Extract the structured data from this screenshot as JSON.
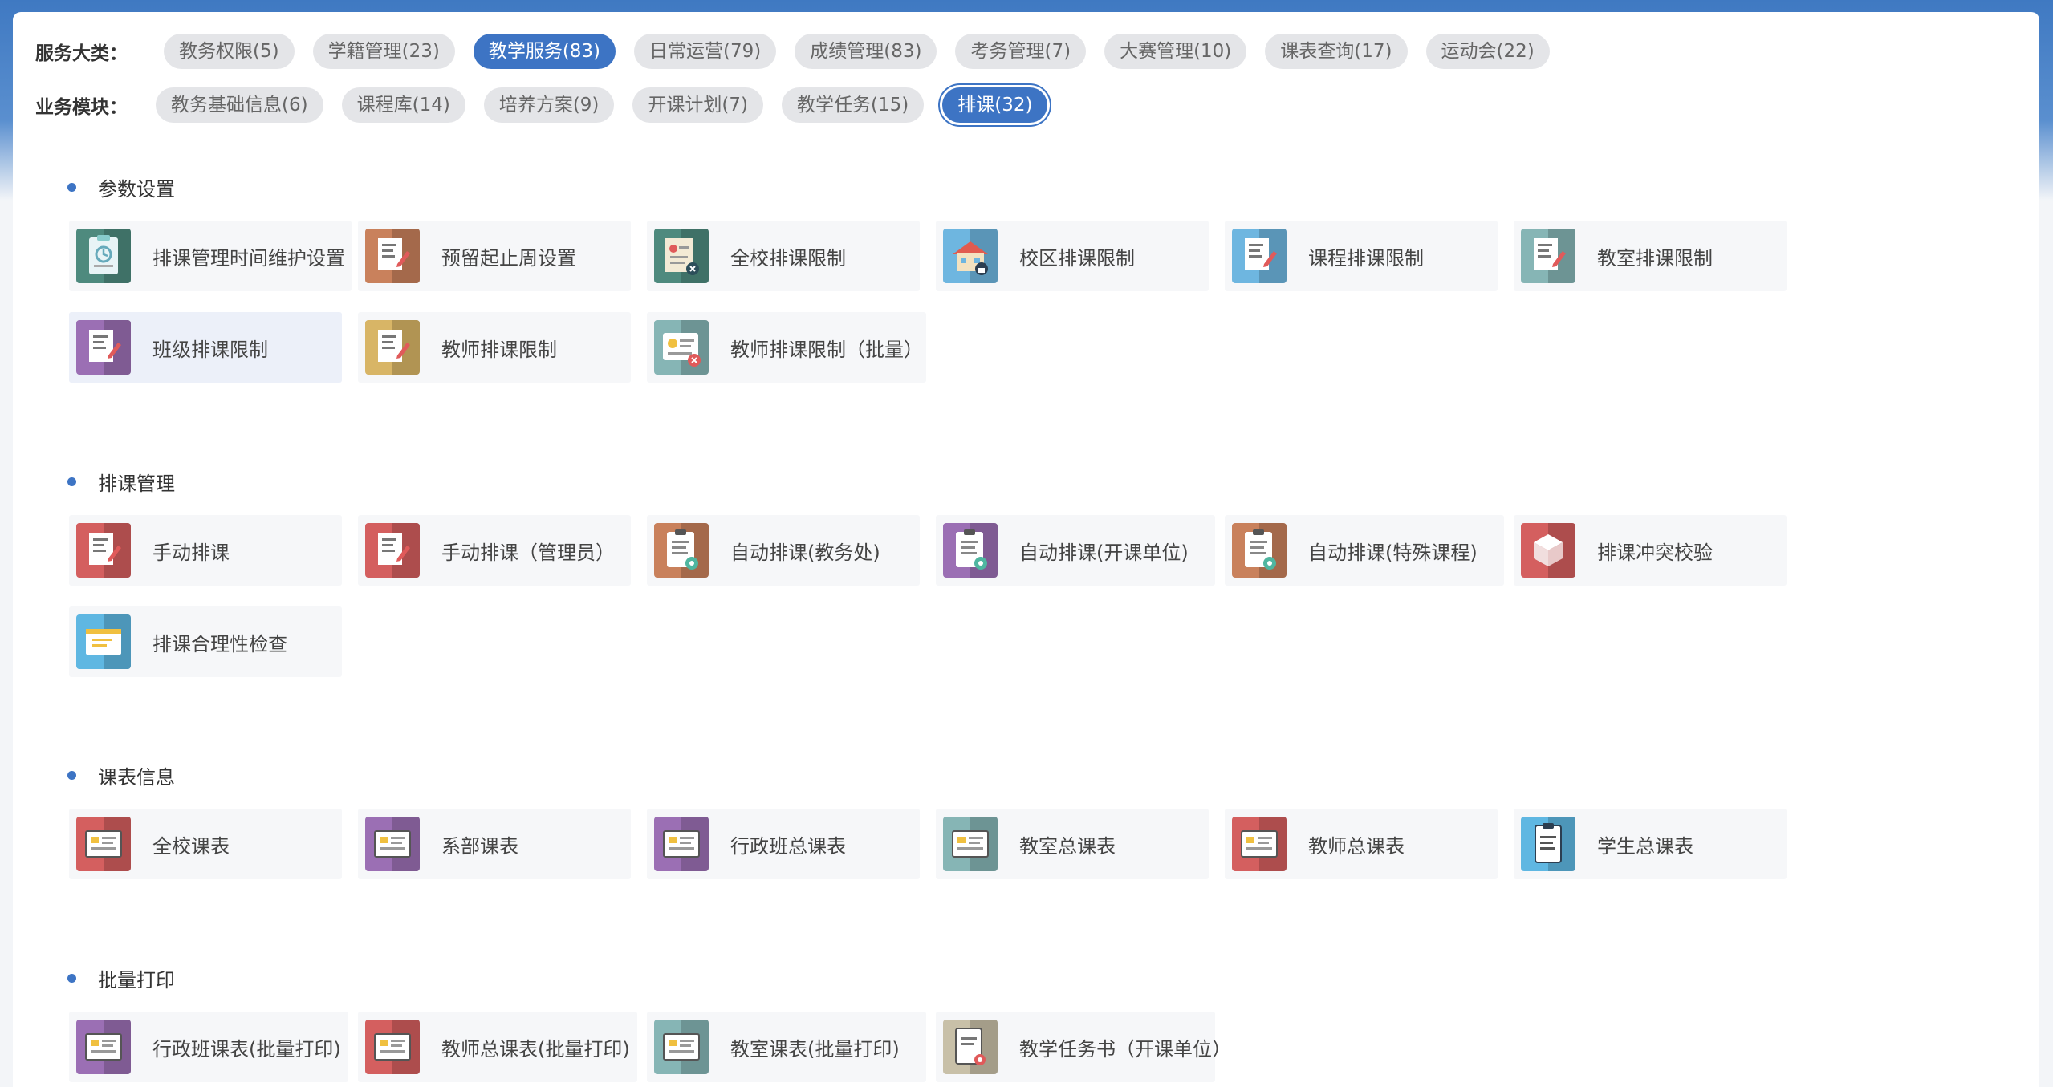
{
  "filters": {
    "category_label": "服务大类：",
    "category_chips": [
      {
        "label": "教务权限(5)",
        "active": false
      },
      {
        "label": "学籍管理(23)",
        "active": false
      },
      {
        "label": "教学服务(83)",
        "active": true
      },
      {
        "label": "日常运营(79)",
        "active": false
      },
      {
        "label": "成绩管理(83)",
        "active": false
      },
      {
        "label": "考务管理(7)",
        "active": false
      },
      {
        "label": "大赛管理(10)",
        "active": false
      },
      {
        "label": "课表查询(17)",
        "active": false
      },
      {
        "label": "运动会(22)",
        "active": false
      }
    ],
    "module_label": "业务模块：",
    "module_chips": [
      {
        "label": "教务基础信息(6)",
        "active": false
      },
      {
        "label": "课程库(14)",
        "active": false
      },
      {
        "label": "培养方案(9)",
        "active": false
      },
      {
        "label": "开课计划(7)",
        "active": false
      },
      {
        "label": "教学任务(15)",
        "active": false
      },
      {
        "label": "排课(32)",
        "active": true
      }
    ]
  },
  "sections": [
    {
      "title": "参数设置",
      "items": [
        {
          "label": "排课管理时间维护设置",
          "icon": "clipboard-clock-icon",
          "color": "#4e8a7e"
        },
        {
          "label": "预留起止周设置",
          "icon": "document-pen-icon",
          "color": "#c9815c"
        },
        {
          "label": "全校排课限制",
          "icon": "document-x-icon",
          "color": "#4e8a7e"
        },
        {
          "label": "校区排课限制",
          "icon": "building-lock-icon",
          "color": "#6eb6e0"
        },
        {
          "label": "课程排课限制",
          "icon": "document-pen-icon",
          "color": "#6eb6e0"
        },
        {
          "label": "教室排课限制",
          "icon": "document-pen-icon",
          "color": "#86b5b5"
        },
        {
          "label": "班级排课限制",
          "icon": "document-pen-icon",
          "color": "#9b6fb4"
        },
        {
          "label": "教师排课限制",
          "icon": "document-pen-icon",
          "color": "#d8b566"
        },
        {
          "label": "教师排课限制（批量）",
          "icon": "id-card-x-icon",
          "color": "#86b5b5"
        }
      ]
    },
    {
      "title": "排课管理",
      "items": [
        {
          "label": "手动排课",
          "icon": "document-pen-icon",
          "color": "#d45f5f"
        },
        {
          "label": "手动排课（管理员）",
          "icon": "document-pen-icon",
          "color": "#d45f5f"
        },
        {
          "label": "自动排课(教务处)",
          "icon": "clipboard-gear-icon",
          "color": "#c9815c"
        },
        {
          "label": "自动排课(开课单位)",
          "icon": "clipboard-gear-icon",
          "color": "#9b6fb4"
        },
        {
          "label": "自动排课(特殊课程)",
          "icon": "clipboard-gear-icon",
          "color": "#c9815c"
        },
        {
          "label": "排课冲突校验",
          "icon": "cube-icon",
          "color": "#d45f5f"
        },
        {
          "label": "排课合理性检查",
          "icon": "board-icon",
          "color": "#5fb7e2"
        }
      ]
    },
    {
      "title": "课表信息",
      "items": [
        {
          "label": "全校课表",
          "icon": "timetable-icon",
          "color": "#d45f5f"
        },
        {
          "label": "系部课表",
          "icon": "timetable-icon",
          "color": "#9b6fb4"
        },
        {
          "label": "行政班总课表",
          "icon": "timetable-icon",
          "color": "#9b6fb4"
        },
        {
          "label": "教室总课表",
          "icon": "timetable-icon",
          "color": "#86b5b5"
        },
        {
          "label": "教师总课表",
          "icon": "timetable-icon",
          "color": "#d45f5f"
        },
        {
          "label": "学生总课表",
          "icon": "clipboard-icon",
          "color": "#5fb7e2"
        }
      ]
    },
    {
      "title": "批量打印",
      "items": [
        {
          "label": "行政班课表(批量打印)",
          "icon": "timetable-icon",
          "color": "#9b6fb4"
        },
        {
          "label": "教师总课表(批量打印)",
          "icon": "timetable-icon",
          "color": "#d45f5f"
        },
        {
          "label": "教室课表(批量打印)",
          "icon": "timetable-icon",
          "color": "#86b5b5"
        },
        {
          "label": "教学任务书（开课单位）",
          "icon": "clipboard-search-icon",
          "color": "#c8c0a8"
        }
      ]
    }
  ]
}
